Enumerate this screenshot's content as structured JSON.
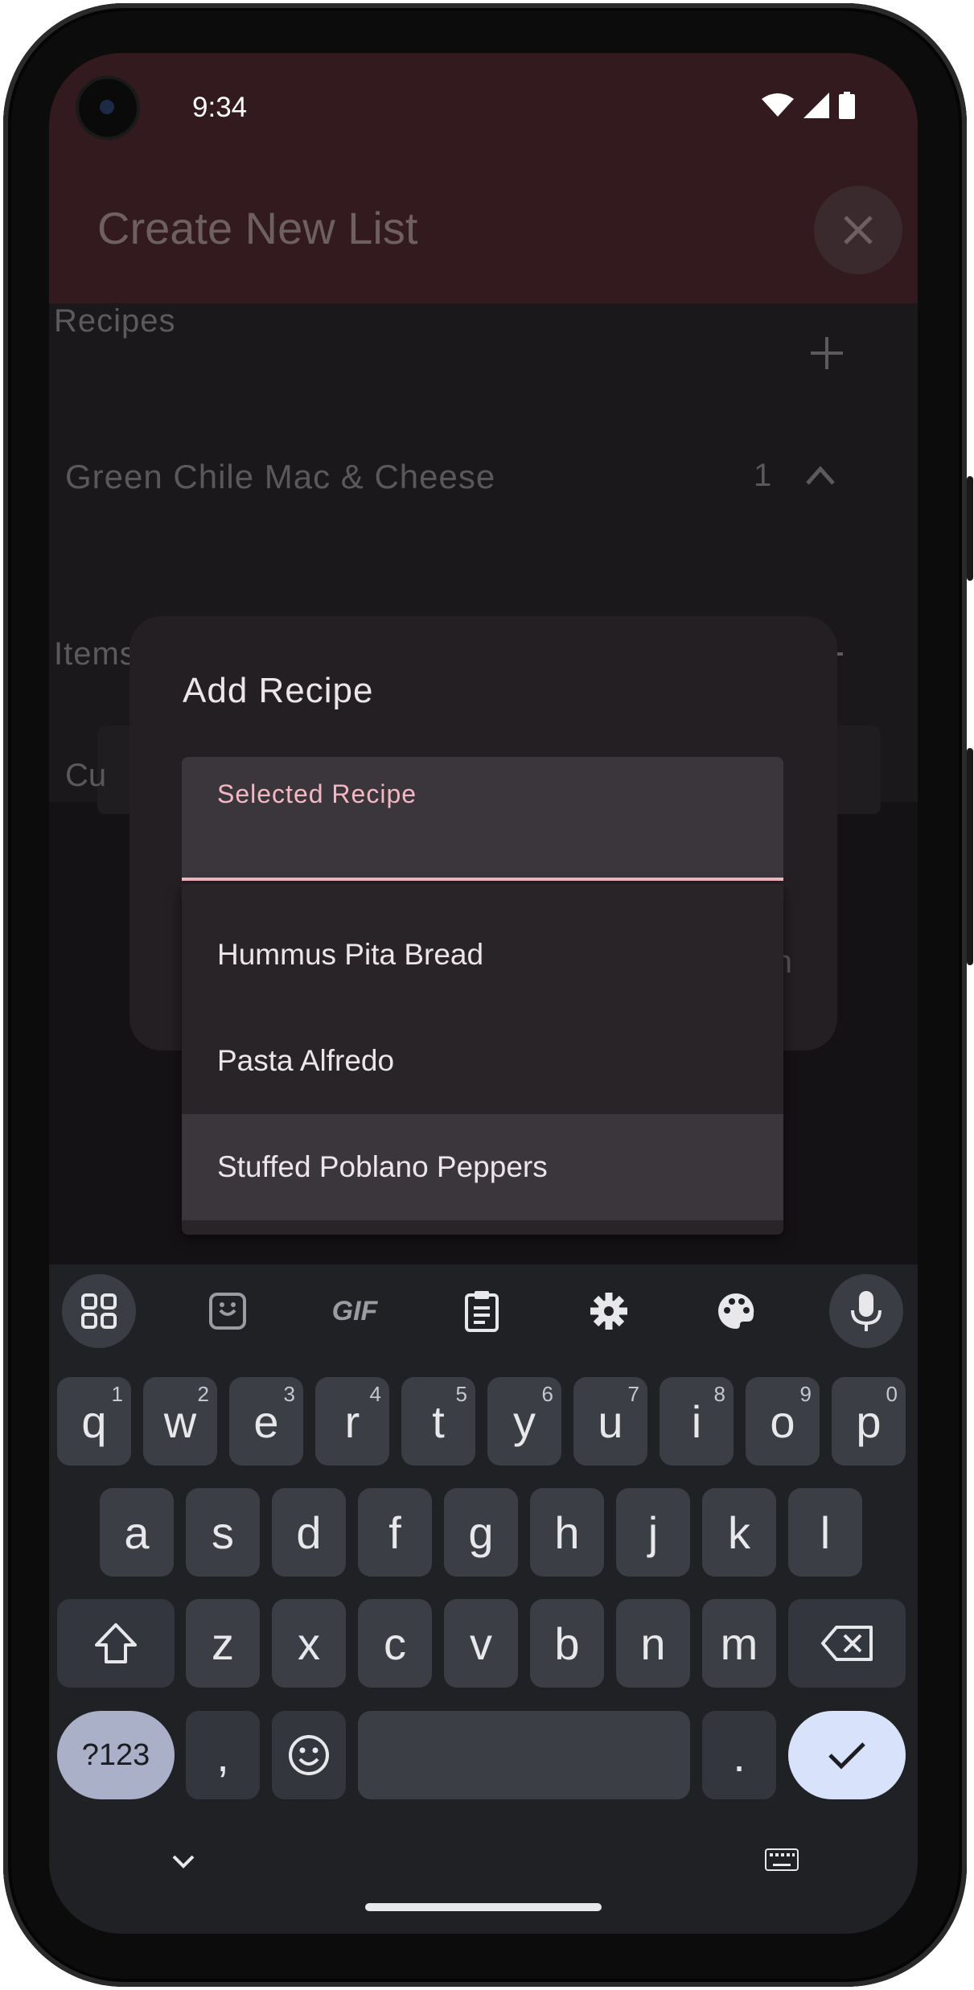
{
  "status_bar": {
    "time": "9:34"
  },
  "app_bar": {
    "title": "Create New List"
  },
  "content": {
    "recipes_label": "Recipes",
    "recipe_row": {
      "name": "Green Chile Mac & Cheese",
      "count": "1"
    },
    "items_label": "Items",
    "custom_partial": "Cu"
  },
  "dialog": {
    "title": "Add Recipe",
    "field_label": "Selected Recipe",
    "field_value": "",
    "trailing_partial": "n",
    "options": [
      "Hummus Pita Bread",
      "Pasta Alfredo",
      "Stuffed Poblano Peppers"
    ],
    "highlighted_index": 2
  },
  "keyboard": {
    "toolbar_icons": [
      "apps-grid-icon",
      "sticker-icon",
      "gif-icon",
      "clipboard-icon",
      "settings-gear-icon",
      "palette-icon",
      "microphone-icon"
    ],
    "gif_label": "GIF",
    "row1": [
      {
        "k": "q",
        "s": "1"
      },
      {
        "k": "w",
        "s": "2"
      },
      {
        "k": "e",
        "s": "3"
      },
      {
        "k": "r",
        "s": "4"
      },
      {
        "k": "t",
        "s": "5"
      },
      {
        "k": "y",
        "s": "6"
      },
      {
        "k": "u",
        "s": "7"
      },
      {
        "k": "i",
        "s": "8"
      },
      {
        "k": "o",
        "s": "9"
      },
      {
        "k": "p",
        "s": "0"
      }
    ],
    "row2": [
      "a",
      "s",
      "d",
      "f",
      "g",
      "h",
      "j",
      "k",
      "l"
    ],
    "row3": [
      "z",
      "x",
      "c",
      "v",
      "b",
      "n",
      "m"
    ],
    "symbols_label": "?123",
    "comma": ",",
    "period": "."
  },
  "colors": {
    "app_bar_bg": "#331a1f",
    "accent": "#f5b8c3",
    "dialog_bg": "#231f23",
    "keyboard_bg": "#1f2125",
    "key_bg": "#3b3e44",
    "confirm_key_bg": "#d8e2fb"
  }
}
